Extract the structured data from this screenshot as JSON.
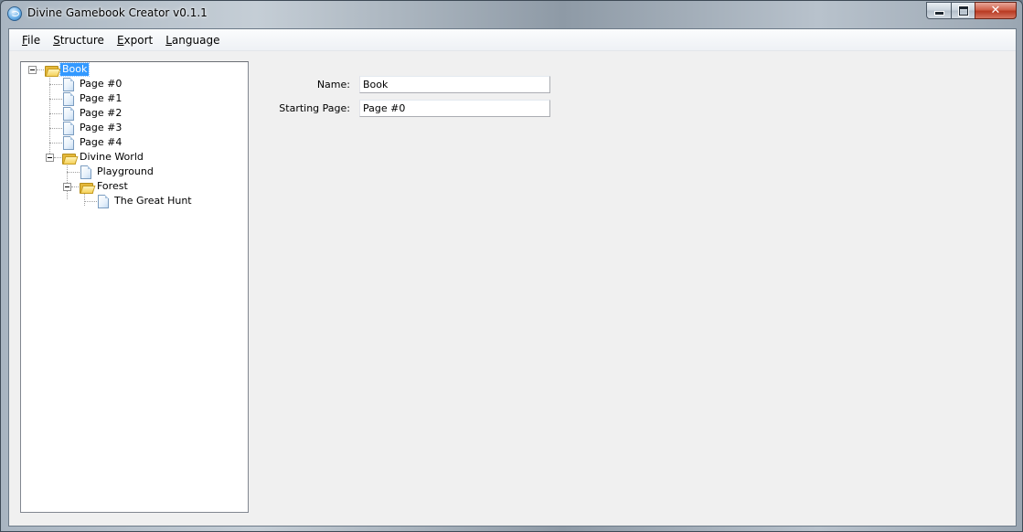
{
  "window": {
    "title": "Divine Gamebook Creator v0.1.1"
  },
  "caption_buttons": {
    "close_glyph": "✕"
  },
  "menu": {
    "items": [
      {
        "label_first": "F",
        "label_rest": "ile"
      },
      {
        "label_first": "S",
        "label_rest": "tructure"
      },
      {
        "label_first": "E",
        "label_rest": "xport"
      },
      {
        "label_first": "L",
        "label_rest": "anguage"
      }
    ]
  },
  "tree": {
    "nodes": [
      {
        "label": "Book",
        "type": "folder",
        "level": 0,
        "selected": true,
        "expanded": true
      },
      {
        "label": "Page #0",
        "type": "page",
        "level": 1
      },
      {
        "label": "Page #1",
        "type": "page",
        "level": 1
      },
      {
        "label": "Page #2",
        "type": "page",
        "level": 1
      },
      {
        "label": "Page #3",
        "type": "page",
        "level": 1
      },
      {
        "label": "Page #4",
        "type": "page",
        "level": 1
      },
      {
        "label": "Divine World",
        "type": "folder",
        "level": 1,
        "expanded": true
      },
      {
        "label": "Playground",
        "type": "page",
        "level": 2
      },
      {
        "label": "Forest",
        "type": "folder",
        "level": 2,
        "expanded": true
      },
      {
        "label": "The Great Hunt",
        "type": "page",
        "level": 3
      }
    ]
  },
  "properties": {
    "name_label": "Name:",
    "name_value": "Book",
    "starting_page_label": "Starting Page:",
    "starting_page_value": "Page #0"
  },
  "colors": {
    "selection": "#3399ff",
    "client_bg": "#f0f0f0",
    "close_button": "#c7432b"
  }
}
